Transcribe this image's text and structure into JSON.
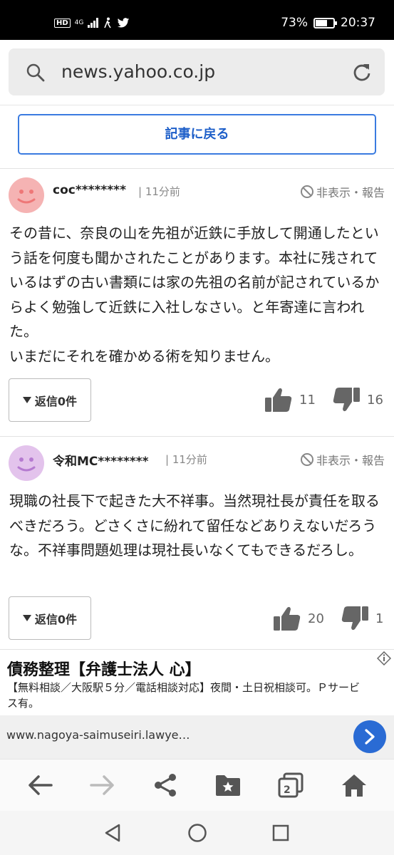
{
  "status_bar": {
    "network": "4G",
    "battery": "73%",
    "battery_level": 0.73,
    "time": "20:37",
    "icons": [
      "hd-icon",
      "signal-icon",
      "walking-icon",
      "twitter-icon",
      "battery-icon"
    ]
  },
  "url_bar": {
    "url": "news.yahoo.co.jp",
    "icons": [
      "search-icon",
      "reload-icon"
    ]
  },
  "back_button": "記事に戻る",
  "comments": [
    {
      "user": "coc********",
      "time": "11分前",
      "hide_report": "非表示・報告",
      "avatar_color": "#f5b3b3",
      "body": "その昔に、奈良の山を先祖が近鉄に手放して開通したという話を何度も聞かされたことがあります。本社に残されているはずの古い書類には家の先祖の名前が記されているからよく勉強して近鉄に入社しなさい。と年寄達に言われた。\nいまだにそれを確かめる術を知りません。",
      "reply_label": "返信0件",
      "likes": "11",
      "dislikes": "16"
    },
    {
      "user": "令和MC********",
      "time": "11分前",
      "hide_report": "非表示・報告",
      "avatar_color": "#e3c3ec",
      "body": "現職の社長下で起きた大不祥事。当然現社長が責任を取るべきだろう。どさくさに紛れて留任などありえないだろうな。不祥事問題処理は現社長いなくてもできるだろし。",
      "reply_label": "返信0件",
      "likes": "20",
      "dislikes": "1"
    }
  ],
  "ad": {
    "title": "債務整理【弁護士法人 心】",
    "description": "【無料相談／大阪駅５分／電話相談対応】夜間・土日祝相談可。Ｐサービス有。",
    "url": "www.nagoya-saimuseiri.lawye…",
    "accent": "#2a6bd4"
  },
  "toolbar": {
    "tab_count": "2",
    "icons": [
      "back-arrow-icon",
      "forward-arrow-icon",
      "share-icon",
      "bookmark-folder-icon",
      "tabs-icon",
      "home-icon"
    ]
  },
  "system_nav": {
    "icons": [
      "nav-back-icon",
      "nav-home-icon",
      "nav-recents-icon"
    ]
  }
}
